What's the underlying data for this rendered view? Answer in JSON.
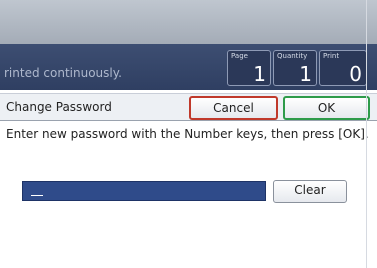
{
  "status": {
    "message": "rinted continuously.",
    "counters": [
      {
        "label": "Page",
        "value": "1"
      },
      {
        "label": "Quantity",
        "value": "1"
      },
      {
        "label": "Print",
        "value": "0"
      }
    ]
  },
  "dialog": {
    "title": "Change Password",
    "cancel_label": "Cancel",
    "ok_label": "OK",
    "instruction": "Enter new password with the Number keys, then press [OK].",
    "password_value": "",
    "clear_label": "Clear"
  }
}
